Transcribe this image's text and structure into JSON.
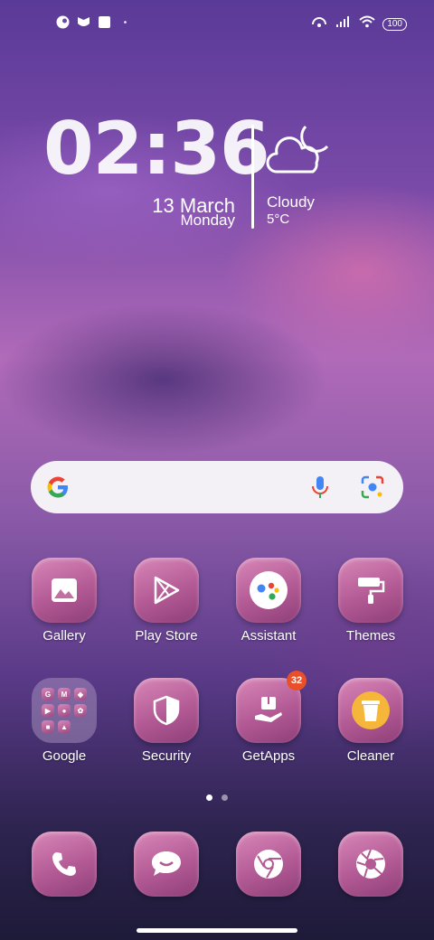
{
  "status_bar": {
    "left_icons": [
      "notification-icon-1",
      "notification-icon-2",
      "notification-icon-3",
      "dot-icon"
    ],
    "right_icons": [
      "hotspot-icon",
      "signal-icon",
      "wifi-icon"
    ],
    "battery": "100"
  },
  "clock_widget": {
    "time": "02:36",
    "date": "13  March",
    "weekday": "Monday",
    "weather_condition": "Cloudy",
    "temperature": "5°C"
  },
  "search_bar": {
    "logo": "google-logo",
    "mic_icon": "mic-icon",
    "lens_icon": "lens-icon"
  },
  "apps_row1": [
    {
      "label": "Gallery",
      "icon": "gallery-icon"
    },
    {
      "label": "Play Store",
      "icon": "play-store-icon"
    },
    {
      "label": "Assistant",
      "icon": "assistant-icon"
    },
    {
      "label": "Themes",
      "icon": "themes-icon"
    }
  ],
  "apps_row2": [
    {
      "label": "Google",
      "icon": "folder-icon"
    },
    {
      "label": "Security",
      "icon": "security-icon"
    },
    {
      "label": "GetApps",
      "icon": "getapps-icon",
      "badge": "32"
    },
    {
      "label": "Cleaner",
      "icon": "cleaner-icon"
    }
  ],
  "folder_minis": [
    "G",
    "M",
    "",
    "",
    "",
    "",
    "",
    ""
  ],
  "dock": [
    "phone-icon",
    "messages-icon",
    "browser-icon",
    "camera-icon"
  ],
  "page_indicator": {
    "pages": 2,
    "active": 1
  },
  "colors": {
    "tile_top": "#d887b8",
    "tile_bottom": "#8e3f78",
    "badge": "#e8502a",
    "search_bg": "#f3f0f6"
  }
}
